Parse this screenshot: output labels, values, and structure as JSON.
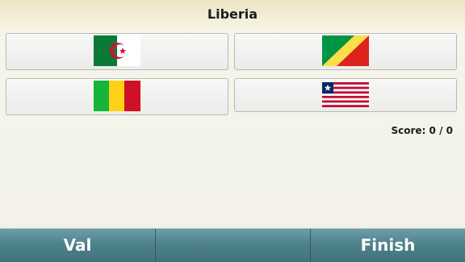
{
  "question": {
    "country": "Liberia"
  },
  "options": [
    {
      "flag": "algeria-flag"
    },
    {
      "flag": "congo-flag"
    },
    {
      "flag": "mali-flag"
    },
    {
      "flag": "liberia-flag"
    }
  ],
  "score": {
    "text": "Score: 0 / 0"
  },
  "softkeys": {
    "left": "Val",
    "middle": "",
    "right": "Finish"
  },
  "colors": {
    "softkey_bar": "#4f838c",
    "title_bar": "#ece5c3",
    "background": "#f4f3ea"
  }
}
